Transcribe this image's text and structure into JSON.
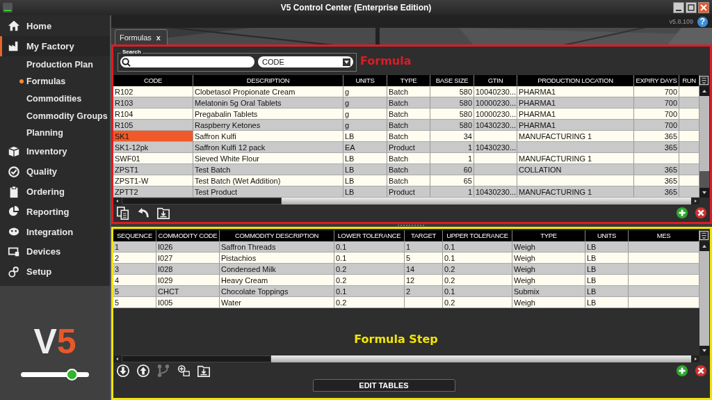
{
  "window": {
    "title": "V5 Control Center (Enterprise Edition)"
  },
  "header": {
    "version": "v5.8.109",
    "help": "?"
  },
  "sidebar": {
    "items": [
      {
        "label": "Home",
        "selected": false
      },
      {
        "label": "My Factory",
        "selected": true,
        "children": [
          {
            "label": "Production Plan",
            "selected": false
          },
          {
            "label": "Formulas",
            "selected": true
          },
          {
            "label": "Commodities",
            "selected": false
          },
          {
            "label": "Commodity Groups",
            "selected": false
          },
          {
            "label": "Planning",
            "selected": false
          }
        ]
      },
      {
        "label": "Inventory",
        "selected": false
      },
      {
        "label": "Quality",
        "selected": false
      },
      {
        "label": "Ordering",
        "selected": false
      },
      {
        "label": "Reporting",
        "selected": false
      },
      {
        "label": "Integration",
        "selected": false
      },
      {
        "label": "Devices",
        "selected": false
      },
      {
        "label": "Setup",
        "selected": false
      }
    ],
    "logo": {
      "letter": "V",
      "digit": "5"
    },
    "slider": {
      "level": 0.76
    }
  },
  "tabs": [
    {
      "label": "Formulas",
      "close": "x",
      "selected": true
    }
  ],
  "formula_panel": {
    "label": "Formula",
    "search": {
      "legend": "Search",
      "field": "CODE"
    },
    "table": {
      "columns": [
        "CODE",
        "DESCRIPTION",
        "UNITS",
        "TYPE",
        "BASE SIZE",
        "GTIN",
        "PRODUCTION LOCATION",
        "EXPIRY DAYS",
        "RUN"
      ],
      "rows": [
        {
          "selected": false,
          "cells": [
            "R102",
            "Clobetasol Propionate Cream",
            "g",
            "Batch",
            "580",
            "10040230...",
            "PHARMA1",
            "700",
            ""
          ]
        },
        {
          "selected": false,
          "cells": [
            "R103",
            "Melatonin 5g Oral Tablets",
            "g",
            "Batch",
            "580",
            "10000230...",
            "PHARMA1",
            "700",
            ""
          ]
        },
        {
          "selected": false,
          "cells": [
            "R104",
            "Pregabalin Tablets",
            "g",
            "Batch",
            "580",
            "10000230...",
            "PHARMA1",
            "700",
            ""
          ]
        },
        {
          "selected": false,
          "cells": [
            "R105",
            "Raspberry Ketones",
            "g",
            "Batch",
            "580",
            "10430230...",
            "PHARMA1",
            "700",
            ""
          ]
        },
        {
          "selected": true,
          "cells": [
            "SK1",
            "Saffron Kulfi",
            "LB",
            "Batch",
            "34",
            "",
            "MANUFACTURING 1",
            "365",
            ""
          ]
        },
        {
          "selected": false,
          "cells": [
            "SK1-12pk",
            "Saffron Kulfi 12 pack",
            "EA",
            "Product",
            "1",
            "10430230...",
            "",
            "365",
            ""
          ]
        },
        {
          "selected": false,
          "cells": [
            "SWF01",
            "Sieved White Flour",
            "LB",
            "Batch",
            "1",
            "",
            "MANUFACTURING 1",
            "",
            ""
          ]
        },
        {
          "selected": false,
          "cells": [
            "ZPST1",
            "Test Batch",
            "LB",
            "Batch",
            "60",
            "",
            "COLLATION",
            "365",
            ""
          ]
        },
        {
          "selected": false,
          "cells": [
            "ZPST1-W",
            "Test Batch (Wet Addition)",
            "LB",
            "Batch",
            "65",
            "",
            "",
            "365",
            ""
          ]
        },
        {
          "selected": false,
          "cells": [
            "ZPTT2",
            "Test Product",
            "LB",
            "Product",
            "1",
            "10430230...",
            "MANUFACTURING 1",
            "365",
            ""
          ]
        }
      ]
    }
  },
  "step_panel": {
    "label": "Formula Step",
    "button": "EDIT TABLES",
    "table": {
      "columns": [
        "SEQUENCE",
        "COMMODITY CODE",
        "COMMODITY DESCRIPTION",
        "LOWER TOLERANCE",
        "TARGET",
        "UPPER TOLERANCE",
        "TYPE",
        "UNITS",
        "MES"
      ],
      "rows": [
        {
          "cells": [
            "1",
            "I026",
            "Saffron Threads",
            "0.1",
            "1",
            "0.1",
            "Weigh",
            "LB",
            ""
          ]
        },
        {
          "cells": [
            "2",
            "I027",
            "Pistachios",
            "0.1",
            "5",
            "0.1",
            "Weigh",
            "LB",
            ""
          ]
        },
        {
          "cells": [
            "3",
            "I028",
            "Condensed Milk",
            "0.2",
            "14",
            "0.2",
            "Weigh",
            "LB",
            ""
          ]
        },
        {
          "cells": [
            "4",
            "I029",
            "Heavy Cream",
            "0.2",
            "12",
            "0.2",
            "Weigh",
            "LB",
            ""
          ]
        },
        {
          "cells": [
            "5",
            "CHCT",
            "Chocolate Toppings",
            "0.1",
            "2",
            "0.1",
            "Submix",
            "LB",
            ""
          ]
        },
        {
          "cells": [
            "5",
            "I005",
            "Water",
            "0.2",
            "",
            "0.2",
            "Weigh",
            "LB",
            ""
          ]
        }
      ]
    }
  }
}
